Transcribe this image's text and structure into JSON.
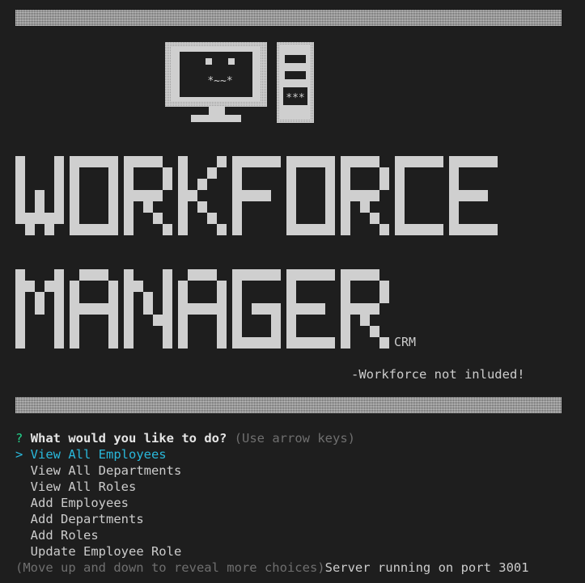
{
  "banner": {
    "title_line1": "WORKFORCE",
    "title_line2": "MANAGER",
    "suffix": "CRM",
    "face": "*~~*",
    "tower_label": "***",
    "tagline": "-Workforce not inluded!"
  },
  "prompt": {
    "marker": "?",
    "question": "What would you like to do?",
    "hint": "(Use arrow keys)",
    "pointer": ">",
    "choices": [
      "View All Employees",
      "View All Departments",
      "View All Roles",
      "Add Employees",
      "Add Departments",
      "Add Roles",
      "Update Employee Role"
    ],
    "selected_index": 0,
    "footer_hint": "(Move up and down to reveal more choices)",
    "server_status": "Server running on port 3001"
  },
  "colors": {
    "background": "#1e1e1e",
    "ascii": "#cfcfcf",
    "selected": "#29b8db",
    "question_mark": "#23d18b"
  }
}
